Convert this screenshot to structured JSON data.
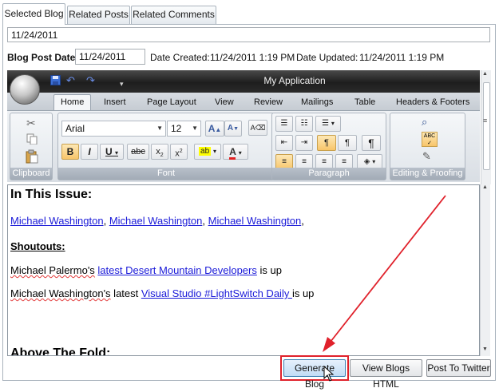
{
  "tabs": [
    {
      "label": "Selected Blog",
      "active": true
    },
    {
      "label": "Related Posts",
      "active": false
    },
    {
      "label": "Related Comments",
      "active": false
    }
  ],
  "header_field": {
    "value": "11/24/2011"
  },
  "blog_post_date": {
    "label": "Blog Post Date:",
    "value": "11/24/2011"
  },
  "date_created": {
    "label": "Date Created:",
    "value": "11/24/2011 1:19 PM"
  },
  "date_updated": {
    "label": "Date Updated:",
    "value": "11/24/2011 1:19 PM"
  },
  "ribbon": {
    "title": "My Application",
    "tabs": [
      "Home",
      "Insert",
      "Page Layout",
      "View",
      "Review",
      "Mailings",
      "Table",
      "Headers & Footers"
    ],
    "font_name": "Arial",
    "font_size": "12",
    "groups": {
      "clipboard": "Clipboard",
      "font": "Font",
      "paragraph": "Paragraph",
      "editing": "Editing & Proofing"
    }
  },
  "document": {
    "heading": "In This Issue:",
    "author_links": [
      "Michael Washington",
      "Michael Washington",
      "Michael Washington"
    ],
    "shoutouts_heading": "Shoutouts:",
    "line1": {
      "prefix_sq": "Michael Palermo's",
      "link": "latest Desert Mountain Developers",
      "suffix": " is up"
    },
    "line2": {
      "prefix_sq": "Michael Washington's",
      "mid": " latest ",
      "link": "Visual Studio #LightSwitch Daily ",
      "suffix": "is up"
    },
    "above_fold": "Above The Fold:"
  },
  "buttons": {
    "generate": "Generate Blog",
    "view_html": "View Blogs HTML",
    "post_twitter": "Post To Twitter"
  },
  "colors": {
    "annotation": "#e0212b",
    "link": "#1a1ad8"
  }
}
